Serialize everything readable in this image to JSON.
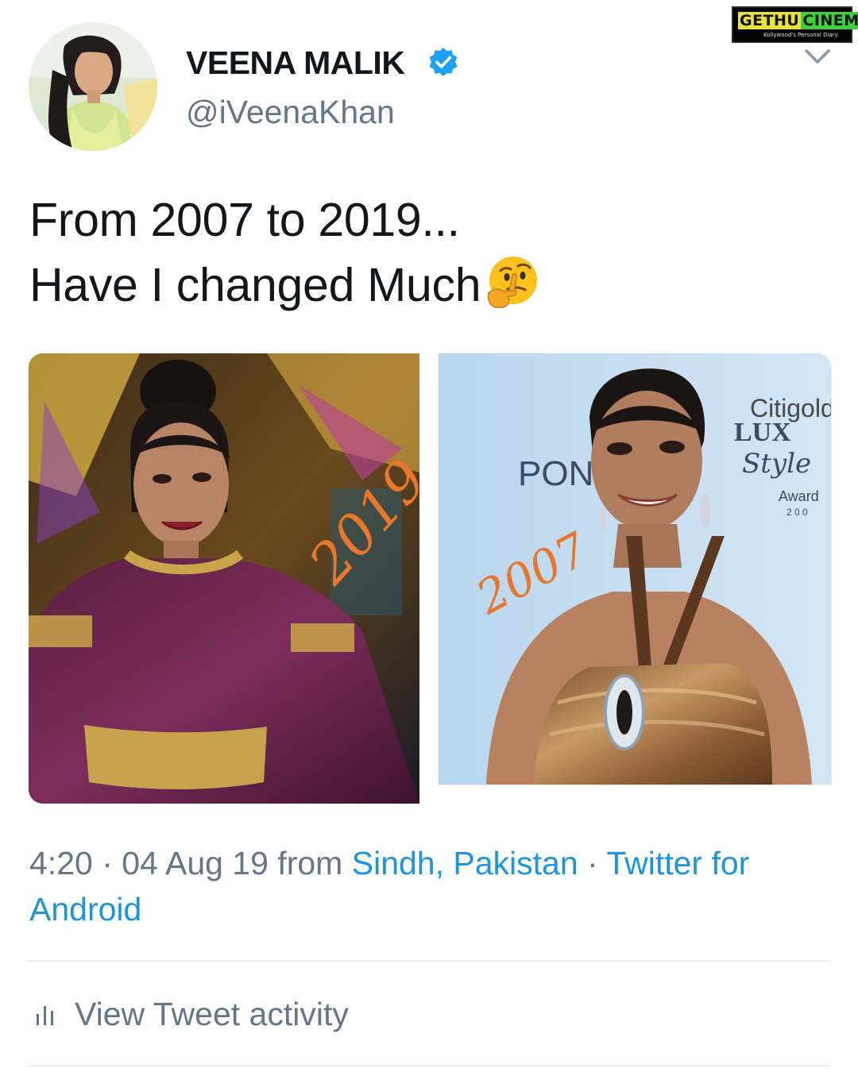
{
  "watermark": {
    "brand_a": "GETHU",
    "brand_b": "CINEMA",
    "tagline": "Kollywood's Personal Diary"
  },
  "author": {
    "name": "VEENA MALIK",
    "handle": "@iVeenaKhan",
    "verified": true,
    "verified_icon": "verified-badge-icon"
  },
  "tweet": {
    "line1": "From 2007 to 2019...",
    "line2": "Have I changed Much",
    "emoji": "thinking-face-emoji"
  },
  "media": [
    {
      "annotation": "2019"
    },
    {
      "annotation": "2007",
      "backdrop_lines": [
        "PON",
        "Citigold",
        "LUX",
        "Style",
        "Award",
        "2 0 0"
      ]
    }
  ],
  "meta": {
    "time": "4:20",
    "separator": " · ",
    "date": "04 Aug 19",
    "from_word": " from ",
    "location": "Sindh, Pakistan",
    "client": "Twitter for Android"
  },
  "actions": {
    "activity_label": "View Tweet activity",
    "activity_icon": "bar-chart-icon",
    "menu_icon": "chevron-down-icon"
  },
  "colors": {
    "link": "#1b95e0",
    "secondary_text": "#657786",
    "primary_text": "#14171a",
    "verified": "#1da1f2"
  }
}
